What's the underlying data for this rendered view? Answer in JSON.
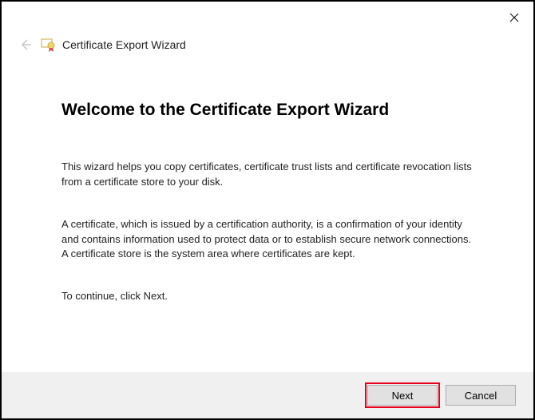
{
  "titlebar": {
    "close_tooltip": "Close"
  },
  "header": {
    "wizard_title": "Certificate Export Wizard"
  },
  "content": {
    "heading": "Welcome to the Certificate Export Wizard",
    "intro": "This wizard helps you copy certificates, certificate trust lists and certificate revocation lists from a certificate store to your disk.",
    "explain": "A certificate, which is issued by a certification authority, is a confirmation of your identity and contains information used to protect data or to establish secure network connections. A certificate store is the system area where certificates are kept.",
    "continue": "To continue, click Next."
  },
  "footer": {
    "next_label": "Next",
    "cancel_label": "Cancel"
  }
}
